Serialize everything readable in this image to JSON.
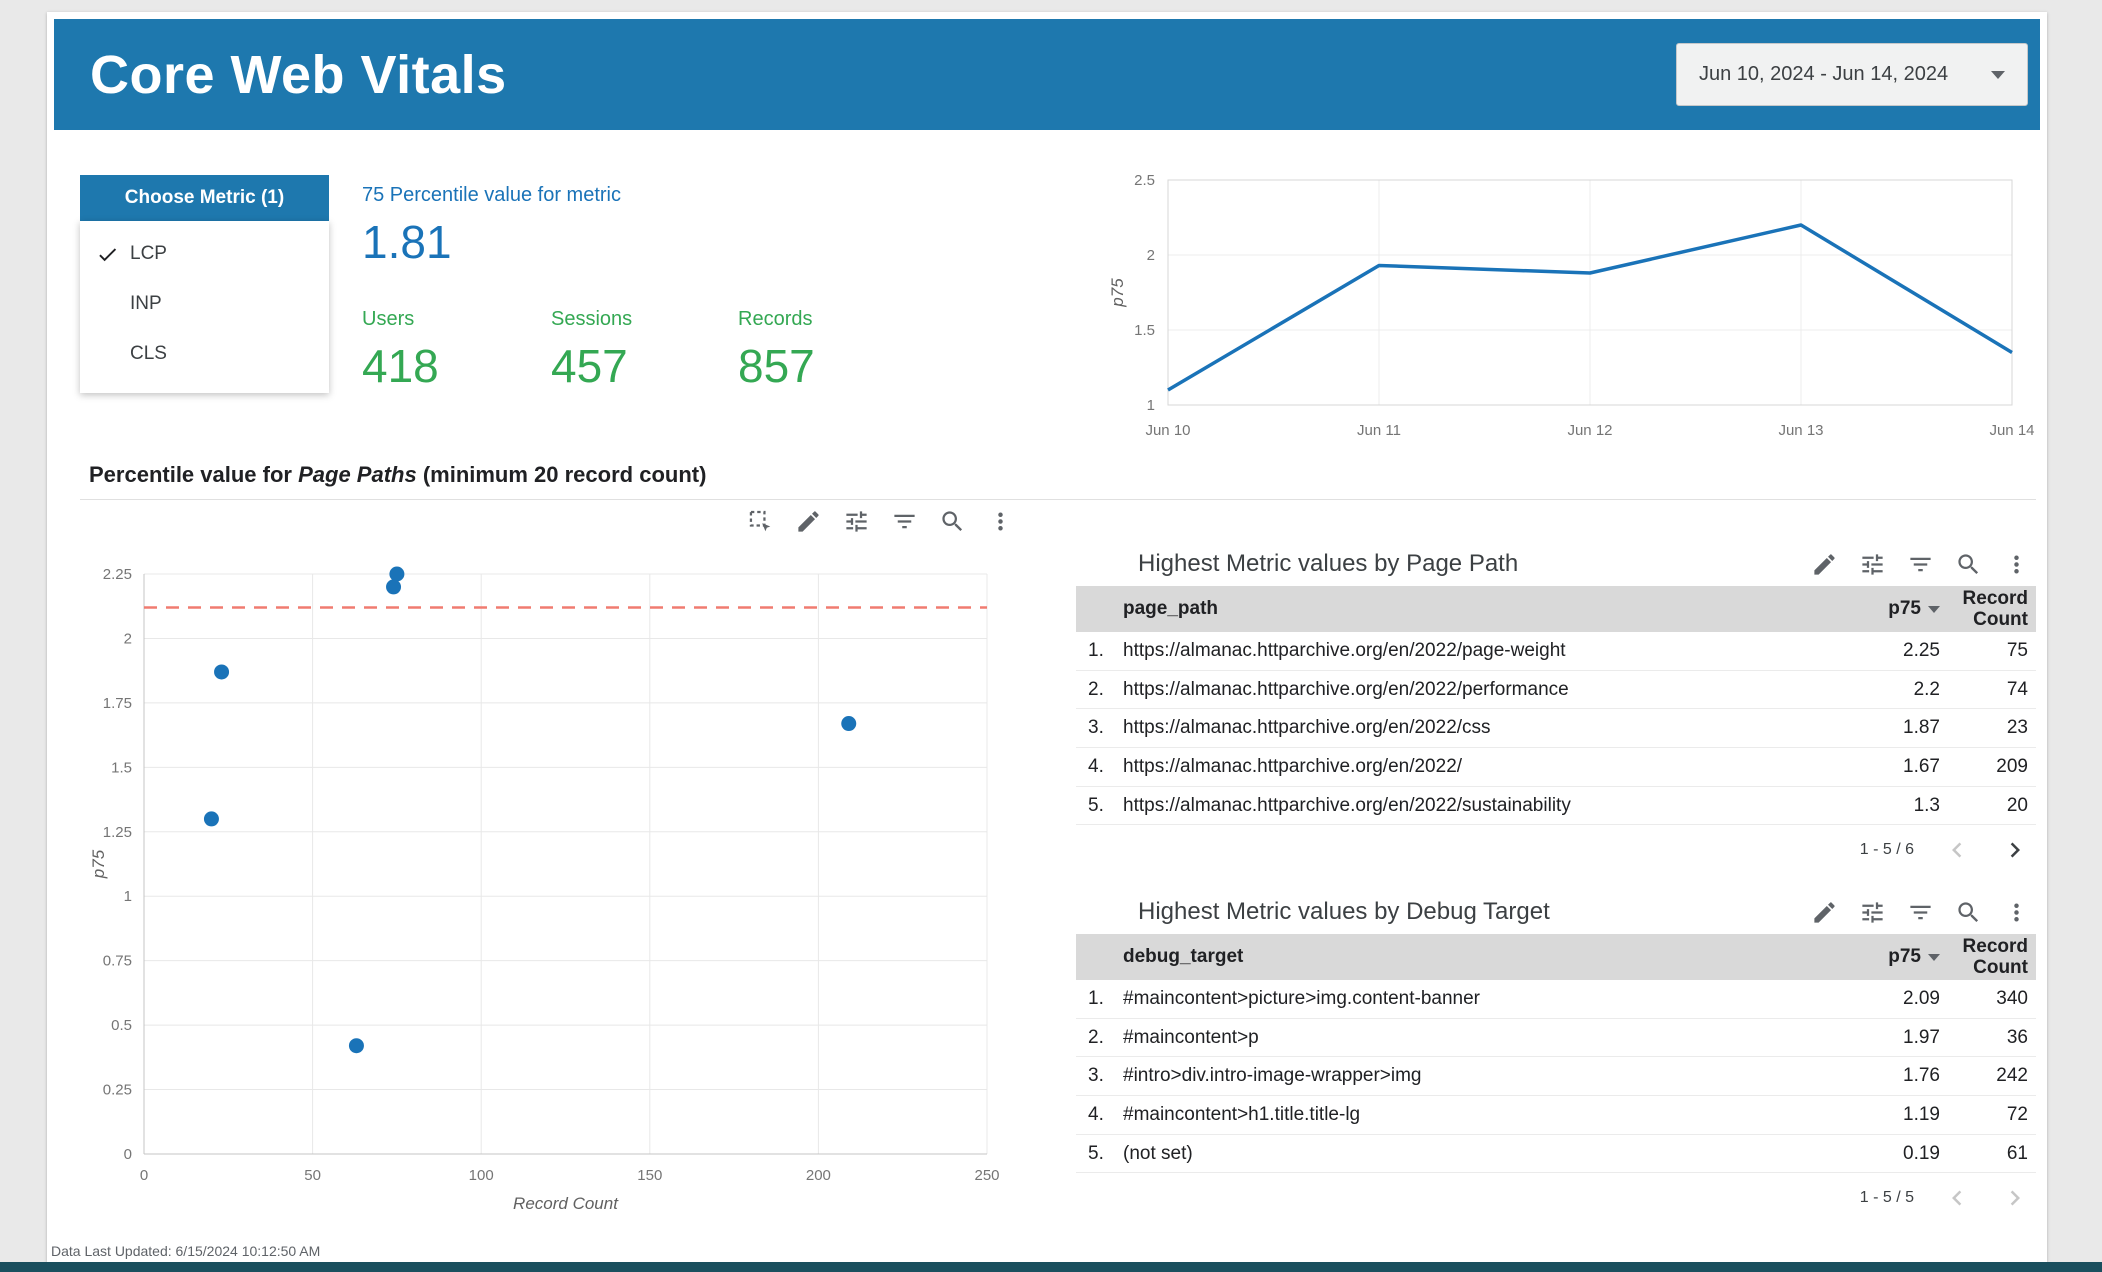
{
  "header": {
    "title": "Core Web Vitals",
    "date_range": "Jun 10, 2024 - Jun 14, 2024"
  },
  "metric_selector": {
    "title": "Choose Metric (1)",
    "options": [
      {
        "label": "LCP",
        "selected": true
      },
      {
        "label": "INP",
        "selected": false
      },
      {
        "label": "CLS",
        "selected": false
      }
    ]
  },
  "scorecards": {
    "metric": {
      "label": "75 Percentile value for metric",
      "value": "1.81"
    },
    "users": {
      "label": "Users",
      "value": "418"
    },
    "sessions": {
      "label": "Sessions",
      "value": "457"
    },
    "records": {
      "label": "Records",
      "value": "857"
    }
  },
  "section_title": {
    "prefix": "Percentile value for ",
    "emphasis": "Page Paths",
    "suffix": " (minimum 20 record count)"
  },
  "chart_data": [
    {
      "type": "line",
      "title": "p75 by date",
      "x": [
        "Jun 10",
        "Jun 11",
        "Jun 12",
        "Jun 13",
        "Jun 14"
      ],
      "series": [
        {
          "name": "p75",
          "values": [
            1.1,
            1.93,
            1.88,
            2.2,
            1.35
          ]
        }
      ],
      "ylabel": "p75",
      "ylim": [
        1,
        2.5
      ],
      "yticks": [
        1,
        1.5,
        2,
        2.5
      ],
      "grid": true,
      "legend": "none",
      "line_color": "#1a73b8"
    },
    {
      "type": "scatter",
      "title": "Percentile value for Page Paths (minimum 20 record count)",
      "xlabel": "Record Count",
      "ylabel": "p75",
      "xlim": [
        0,
        250
      ],
      "ylim": [
        0,
        2.25
      ],
      "xticks": [
        0,
        50,
        100,
        150,
        200,
        250
      ],
      "yticks": [
        0,
        0.25,
        0.5,
        0.75,
        1,
        1.25,
        1.5,
        1.75,
        2,
        2.25
      ],
      "points": [
        {
          "x": 75,
          "y": 2.25
        },
        {
          "x": 74,
          "y": 2.2
        },
        {
          "x": 23,
          "y": 1.87
        },
        {
          "x": 209,
          "y": 1.67
        },
        {
          "x": 20,
          "y": 1.3
        },
        {
          "x": 63,
          "y": 0.42
        }
      ],
      "reference_line": {
        "y": 2.12,
        "dashed": true,
        "color": "#f07b70"
      },
      "point_color": "#1a73b8",
      "grid": true
    }
  ],
  "tables": {
    "page_path": {
      "title": "Highest Metric values by Page Path",
      "columns": {
        "dimension": "page_path",
        "metric": "p75",
        "count": "Record Count"
      },
      "rows": [
        [
          "https://almanac.httparchive.org/en/2022/page-weight",
          "2.25",
          "75"
        ],
        [
          "https://almanac.httparchive.org/en/2022/performance",
          "2.2",
          "74"
        ],
        [
          "https://almanac.httparchive.org/en/2022/css",
          "1.87",
          "23"
        ],
        [
          "https://almanac.httparchive.org/en/2022/",
          "1.67",
          "209"
        ],
        [
          "https://almanac.httparchive.org/en/2022/sustainability",
          "1.3",
          "20"
        ]
      ],
      "pagination": "1 - 5 / 6",
      "prev_enabled": false,
      "next_enabled": true
    },
    "debug_target": {
      "title": "Highest Metric values by Debug Target",
      "columns": {
        "dimension": "debug_target",
        "metric": "p75",
        "count": "Record Count"
      },
      "rows": [
        [
          "#maincontent>picture>img.content-banner",
          "2.09",
          "340"
        ],
        [
          "#maincontent>p",
          "1.97",
          "36"
        ],
        [
          "#intro>div.intro-image-wrapper>img",
          "1.76",
          "242"
        ],
        [
          "#maincontent>h1.title.title-lg",
          "1.19",
          "72"
        ],
        [
          "(not set)",
          "0.19",
          "61"
        ]
      ],
      "pagination": "1 - 5 / 5",
      "prev_enabled": false,
      "next_enabled": false
    }
  },
  "icons": {
    "chart_toolbar": [
      "box-select-icon",
      "edit-icon",
      "tune-icon",
      "filter-icon",
      "zoom-icon",
      "more-vert-icon"
    ],
    "table_toolbar": [
      "edit-icon",
      "tune-icon",
      "filter-icon",
      "zoom-icon",
      "more-vert-icon"
    ]
  },
  "colors": {
    "header_bg": "#1e78ae",
    "accent_blue": "#1a73b8",
    "accent_green": "#34a853",
    "reference_red": "#f07b70",
    "table_header_bg": "#d9d9d9",
    "footer_bar": "#1a4f5e"
  },
  "footer": {
    "last_updated": "Data Last Updated: 6/15/2024 10:12:50 AM"
  }
}
